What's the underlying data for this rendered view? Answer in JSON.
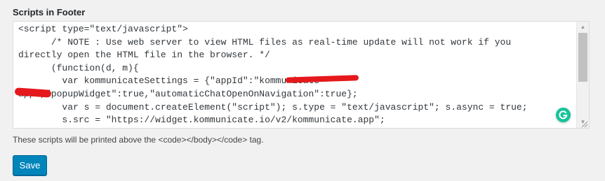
{
  "section": {
    "label": "Scripts in Footer"
  },
  "editor": {
    "lines": [
      "<script type=\"text/javascript\">",
      "      /* NOTE : Use web server to view HTML files as real-time update will not work if you",
      "directly open the HTML file in the browser. */",
      "      (function(d, m){",
      "        var kommunicateSettings = {\"appId\":\"kommunicate-",
      "app\",\"popupWidget\":true,\"automaticChatOpenOnNavigation\":true};",
      "        var s = document.createElement(\"script\"); s.type = \"text/javascript\"; s.async = true;",
      "        s.src = \"https://widget.kommunicate.io/v2/kommunicate.app\";"
    ],
    "redaction_color": "#e5181c"
  },
  "help": {
    "text": "These scripts will be printed above the <code></body></code> tag."
  },
  "actions": {
    "save_label": "Save"
  },
  "colors": {
    "primary_button": "#0085ba",
    "grammarly": "#15c39a"
  },
  "icons": {
    "grammarly": "grammarly-icon",
    "scroll_up": "scroll-up-arrow-icon",
    "scroll_down": "scroll-down-arrow-icon",
    "resize": "resize-handle-icon"
  }
}
